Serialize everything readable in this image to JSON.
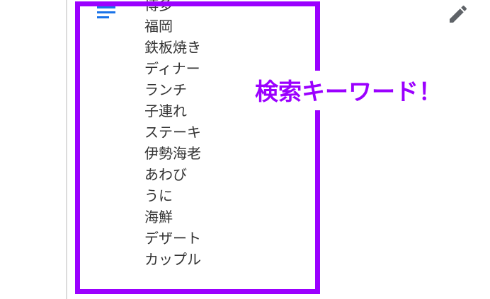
{
  "menu": {
    "icon": "hamburger-menu-icon"
  },
  "edit": {
    "icon": "pencil-edit-icon"
  },
  "keywords": [
    "博多",
    "福岡",
    "鉄板焼き",
    "ディナー",
    "ランチ",
    "子連れ",
    "ステーキ",
    "伊勢海老",
    "あわび",
    "うに",
    "海鮮",
    "デザート",
    "カップル"
  ],
  "callout": {
    "text": "検索キーワード！"
  },
  "colors": {
    "highlight": "#9b00ff",
    "menu_icon": "#1a73e8",
    "edit_icon": "#5f6368",
    "text": "#333333"
  }
}
